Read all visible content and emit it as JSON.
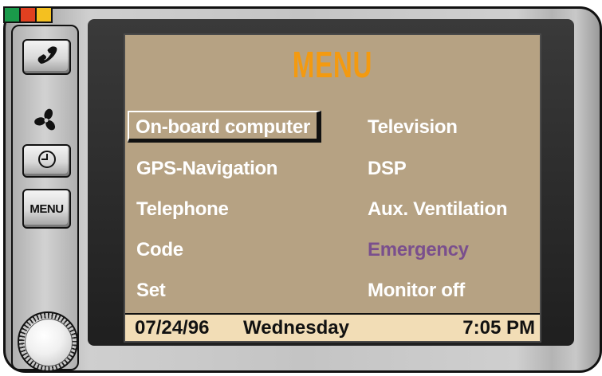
{
  "indicators": [
    {
      "name": "green",
      "color": "#1a9a4a"
    },
    {
      "name": "red",
      "color": "#e04020"
    },
    {
      "name": "yellow",
      "color": "#f4c020"
    }
  ],
  "side_buttons": {
    "phone_icon": "phone-handset-icon",
    "fan_icon": "fan-icon",
    "clock_icon": "clock-icon",
    "menu_label": "MENU"
  },
  "screen": {
    "title": "MENU",
    "left_items": [
      "On-board computer",
      "GPS-Navigation",
      "Telephone",
      "Code",
      "Set"
    ],
    "right_items": [
      "Television",
      "DSP",
      "Aux. Ventilation",
      "Emergency",
      "Monitor off"
    ],
    "selected_item": "On-board computer",
    "status_bar": {
      "date": "07/24/96",
      "day": "Wednesday",
      "time": "7:05 PM"
    }
  },
  "colors": {
    "screen_background": "#b6a283",
    "title": "#f39a10",
    "item_text": "#ffffff",
    "emergency_text": "#7a4f8d",
    "status_bar_background": "#f2ddb6"
  }
}
